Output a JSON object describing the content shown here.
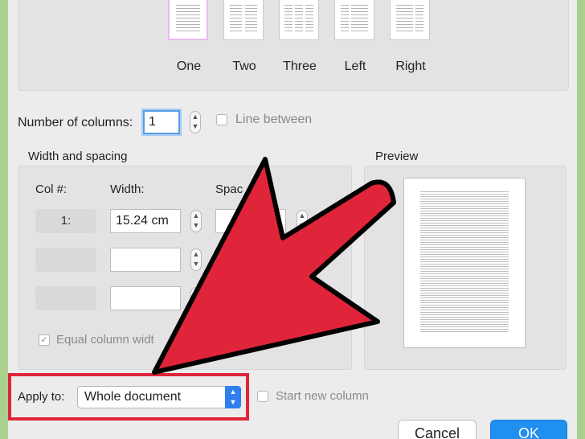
{
  "presets": {
    "items": [
      {
        "label": "One"
      },
      {
        "label": "Two"
      },
      {
        "label": "Three"
      },
      {
        "label": "Left"
      },
      {
        "label": "Right"
      }
    ]
  },
  "columns": {
    "label": "Number of columns:",
    "value": "1",
    "line_between_label": "Line between"
  },
  "width_spacing": {
    "title": "Width and spacing",
    "col_header": "Col #:",
    "width_header": "Width:",
    "spacing_header": "Spac",
    "rows": [
      {
        "col": "1:",
        "width": "15.24 cm"
      },
      {
        "col": "",
        "width": ""
      },
      {
        "col": "",
        "width": ""
      }
    ],
    "equal_width_label": "Equal column widt"
  },
  "preview": {
    "title": "Preview"
  },
  "apply": {
    "label": "Apply to:",
    "selected": "Whole document",
    "start_new_column_label": "Start new column"
  },
  "buttons": {
    "cancel": "Cancel",
    "ok": "OK"
  },
  "colors": {
    "background": "#a9d08e",
    "annotation": "#e0243a",
    "accent": "#1f8ff0"
  }
}
